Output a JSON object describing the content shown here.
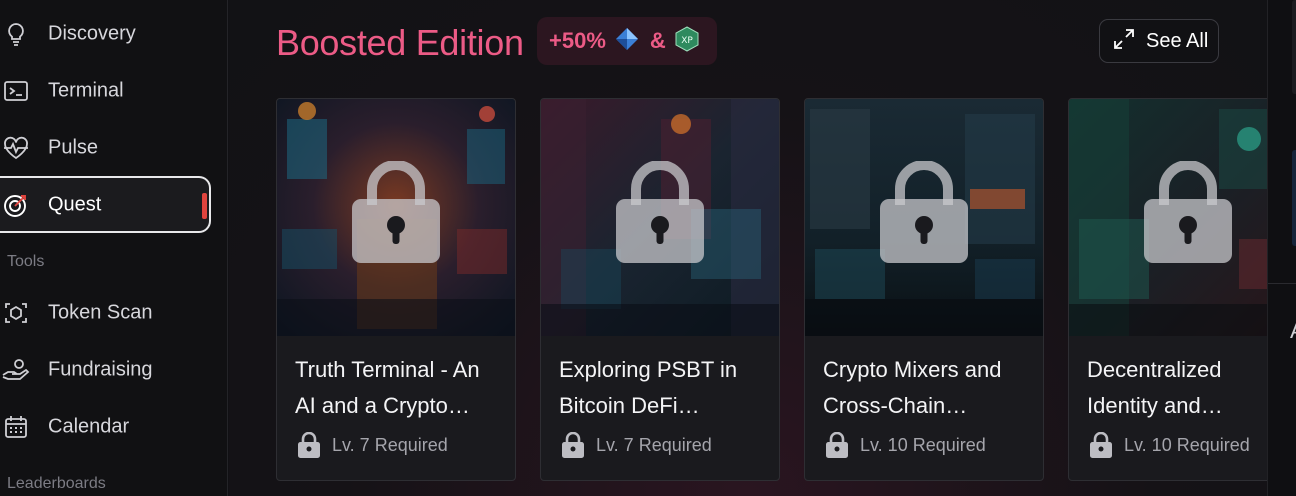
{
  "sidebar": {
    "items": [
      {
        "label": "Discovery",
        "icon": "lightbulb-icon"
      },
      {
        "label": "Terminal",
        "icon": "terminal-icon"
      },
      {
        "label": "Pulse",
        "icon": "heart-pulse-icon"
      },
      {
        "label": "Quest",
        "icon": "target-icon",
        "active": true
      }
    ],
    "tools_label": "Tools",
    "tools": [
      {
        "label": "Token Scan",
        "icon": "token-scan-icon"
      },
      {
        "label": "Fundraising",
        "icon": "hand-coin-icon"
      },
      {
        "label": "Calendar",
        "icon": "calendar-icon"
      }
    ],
    "leaderboards_label": "Leaderboards"
  },
  "main": {
    "heading": "Boosted Edition",
    "boost": {
      "percent": "+50%",
      "amp": "&",
      "token1_icon": "blue-gem-icon",
      "token2_icon": "xp-hexagon-icon",
      "xp_text": "XP"
    },
    "see_all": "See All",
    "cards": [
      {
        "title": "Truth Terminal - An AI and a Crypto…",
        "requirement": "Lv. 7 Required",
        "locked": true
      },
      {
        "title": "Exploring PSBT in Bitcoin DeFi…",
        "requirement": "Lv. 7 Required",
        "locked": true
      },
      {
        "title": "Crypto Mixers and Cross-Chain…",
        "requirement": "Lv. 10 Required",
        "locked": true
      },
      {
        "title": "Decentralized Identity and…",
        "requirement": "Lv. 10 Required",
        "locked": true
      }
    ]
  },
  "right_panel": {
    "partial_glyph": "A"
  },
  "colors": {
    "accent_pink": "#ec5b86",
    "active_marker": "#e0443e",
    "badge_bg": "#2c1620"
  }
}
